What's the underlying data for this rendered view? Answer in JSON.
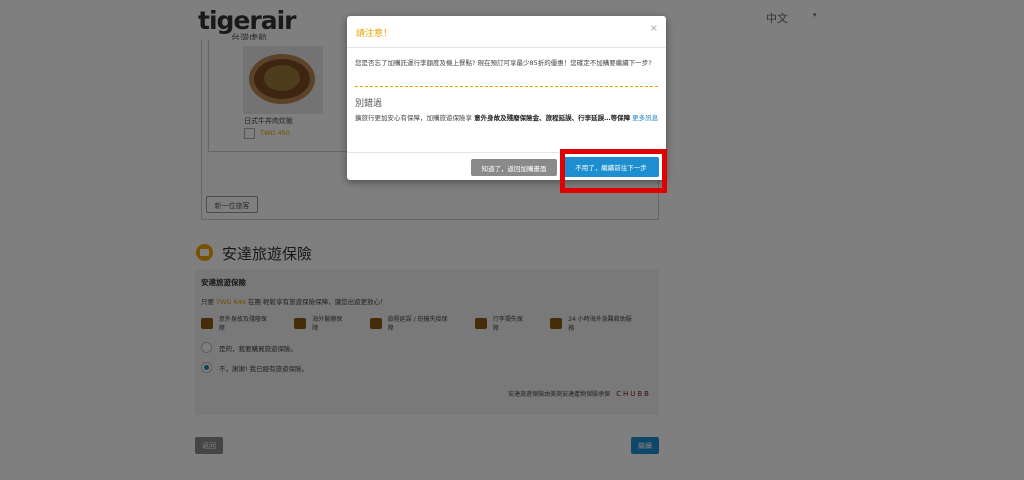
{
  "header": {
    "logo_text": "tigerair",
    "logo_sub": "台灣虎航",
    "language": "中文",
    "language_caret": "▾"
  },
  "meal": {
    "name": "日式牛丼肉炊飯",
    "price": "TWD 450",
    "add_traveler": "新一位旅客"
  },
  "insurance": {
    "heading": "安達旅遊保險",
    "subheading": "安達旅遊保險",
    "desc_prefix": "只要",
    "desc_price": "TWD 646",
    "desc_suffix": "在團 輕鬆享有旅遊保險保障，讓您出遊更放心！",
    "features": [
      {
        "icon": "luggage-medical-icon",
        "label": "意外身故及殘廢保障"
      },
      {
        "icon": "ambulance-icon",
        "label": "海外醫療保障"
      },
      {
        "icon": "plane-delay-icon",
        "label": "旅程延誤 / 班機失接保障"
      },
      {
        "icon": "suitcase-icon",
        "label": "行李損失保障"
      },
      {
        "icon": "clock-24-icon",
        "label": "24 小時海外急難救助服務"
      }
    ],
    "option_yes": "是的，我要購買旅遊保險。",
    "option_no": "不，謝謝! 我已經有旅遊保險。",
    "footer_text": "安達旅遊保險由美商安達產物保險承保",
    "footer_brand": "CHUBB"
  },
  "nav": {
    "back": "返回",
    "next": "繼續"
  },
  "modal": {
    "title": "請注意！",
    "close": "×",
    "message": "您是否忘了加購託運行李額度及機上餐點? 現在預訂可享最少85折的優惠！您確定不加購要繼續下一步?",
    "sub_title": "別錯過",
    "body_prefix": "擴旅行更加安心有保障，加購旅遊保險享",
    "body_bold": "意外身故及殘廢保險金、旅程延誤、行李延誤…等保障",
    "body_more": "更多訊息",
    "btn_back": "知道了，返回加購畫面",
    "btn_continue": "不用了，繼續前往下一步"
  },
  "colors": {
    "accent_orange": "#e8a000",
    "primary_blue": "#1d8fd1",
    "highlight_red": "#e00000"
  }
}
